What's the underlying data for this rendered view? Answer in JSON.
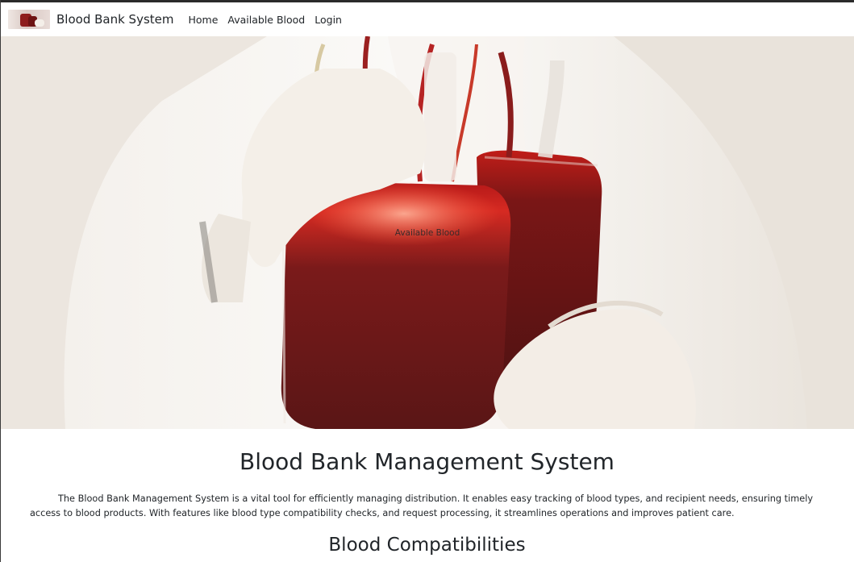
{
  "navbar": {
    "brand": "Blood Bank System",
    "links": [
      "Home",
      "Available Blood",
      "Login"
    ]
  },
  "hero": {
    "overlay_text": "Available Blood"
  },
  "main": {
    "title": "Blood Bank Management System",
    "intro": "The Blood Bank Management System is a vital tool for efficiently managing distribution. It enables easy tracking of blood types, and recipient needs, ensuring timely access to blood products. With features like blood type compatibility checks, and request processing, it streamlines operations and improves patient care.",
    "section_title": "Blood Compatibilities"
  },
  "colors": {
    "blood_red": "#8e1d1d",
    "dark_blood": "#5a1212",
    "text": "#212529"
  }
}
